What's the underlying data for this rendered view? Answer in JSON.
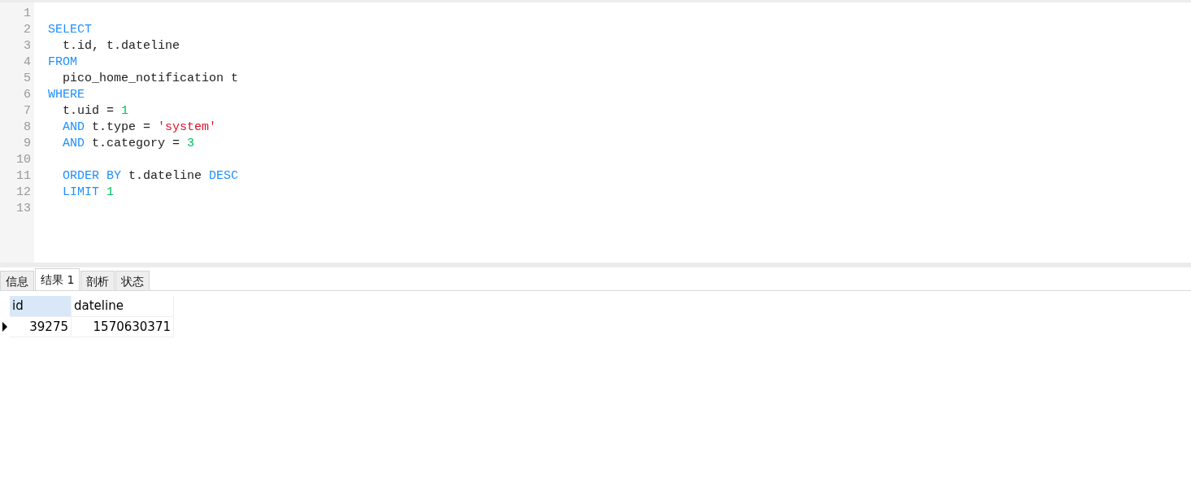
{
  "editor": {
    "lines": [
      {
        "number": "1"
      },
      {
        "number": "2",
        "indented": false,
        "tokens": [
          {
            "kind": "keyword",
            "text": "SELECT"
          }
        ]
      },
      {
        "number": "3",
        "indented": true,
        "tokens": [
          {
            "kind": "plain",
            "text": "t.id, t.dateline"
          }
        ]
      },
      {
        "number": "4",
        "indented": false,
        "tokens": [
          {
            "kind": "keyword",
            "text": "FROM"
          }
        ]
      },
      {
        "number": "5",
        "indented": true,
        "tokens": [
          {
            "kind": "plain",
            "text": "pico_home_notification t"
          }
        ]
      },
      {
        "number": "6",
        "indented": false,
        "tokens": [
          {
            "kind": "keyword",
            "text": "WHERE"
          }
        ]
      },
      {
        "number": "7",
        "indented": true,
        "tokens": [
          {
            "kind": "plain",
            "text": "t.uid ="
          },
          {
            "kind": "number",
            "text": "1"
          }
        ]
      },
      {
        "number": "8",
        "indented": true,
        "tokens": [
          {
            "kind": "keyword",
            "text": "AND"
          },
          {
            "kind": "plain",
            "text": "t.type ="
          },
          {
            "kind": "string",
            "text": "'system'"
          }
        ]
      },
      {
        "number": "9",
        "indented": true,
        "tokens": [
          {
            "kind": "keyword",
            "text": "AND"
          },
          {
            "kind": "plain",
            "text": "t.category ="
          },
          {
            "kind": "number",
            "text": "3"
          }
        ]
      },
      {
        "number": "10"
      },
      {
        "number": "11",
        "indented": true,
        "tokens": [
          {
            "kind": "keyword",
            "text": "ORDER BY"
          },
          {
            "kind": "plain",
            "text": "t.dateline"
          },
          {
            "kind": "keyword",
            "text": "DESC"
          }
        ]
      },
      {
        "number": "12",
        "indented": true,
        "tokens": [
          {
            "kind": "keyword",
            "text": "LIMIT"
          },
          {
            "kind": "number",
            "text": "1"
          }
        ]
      },
      {
        "number": "13"
      }
    ]
  },
  "tabs": [
    {
      "label": "信息",
      "selected": false
    },
    {
      "label": "结果 1",
      "selected": true
    },
    {
      "label": "剖析",
      "selected": false
    },
    {
      "label": "状态",
      "selected": false
    }
  ],
  "results": {
    "columns": [
      {
        "label": "id",
        "selected": true
      },
      {
        "label": "dateline",
        "selected": false
      }
    ],
    "rows": [
      {
        "selected": true,
        "cells": [
          "39275",
          "1570630371"
        ]
      }
    ]
  }
}
